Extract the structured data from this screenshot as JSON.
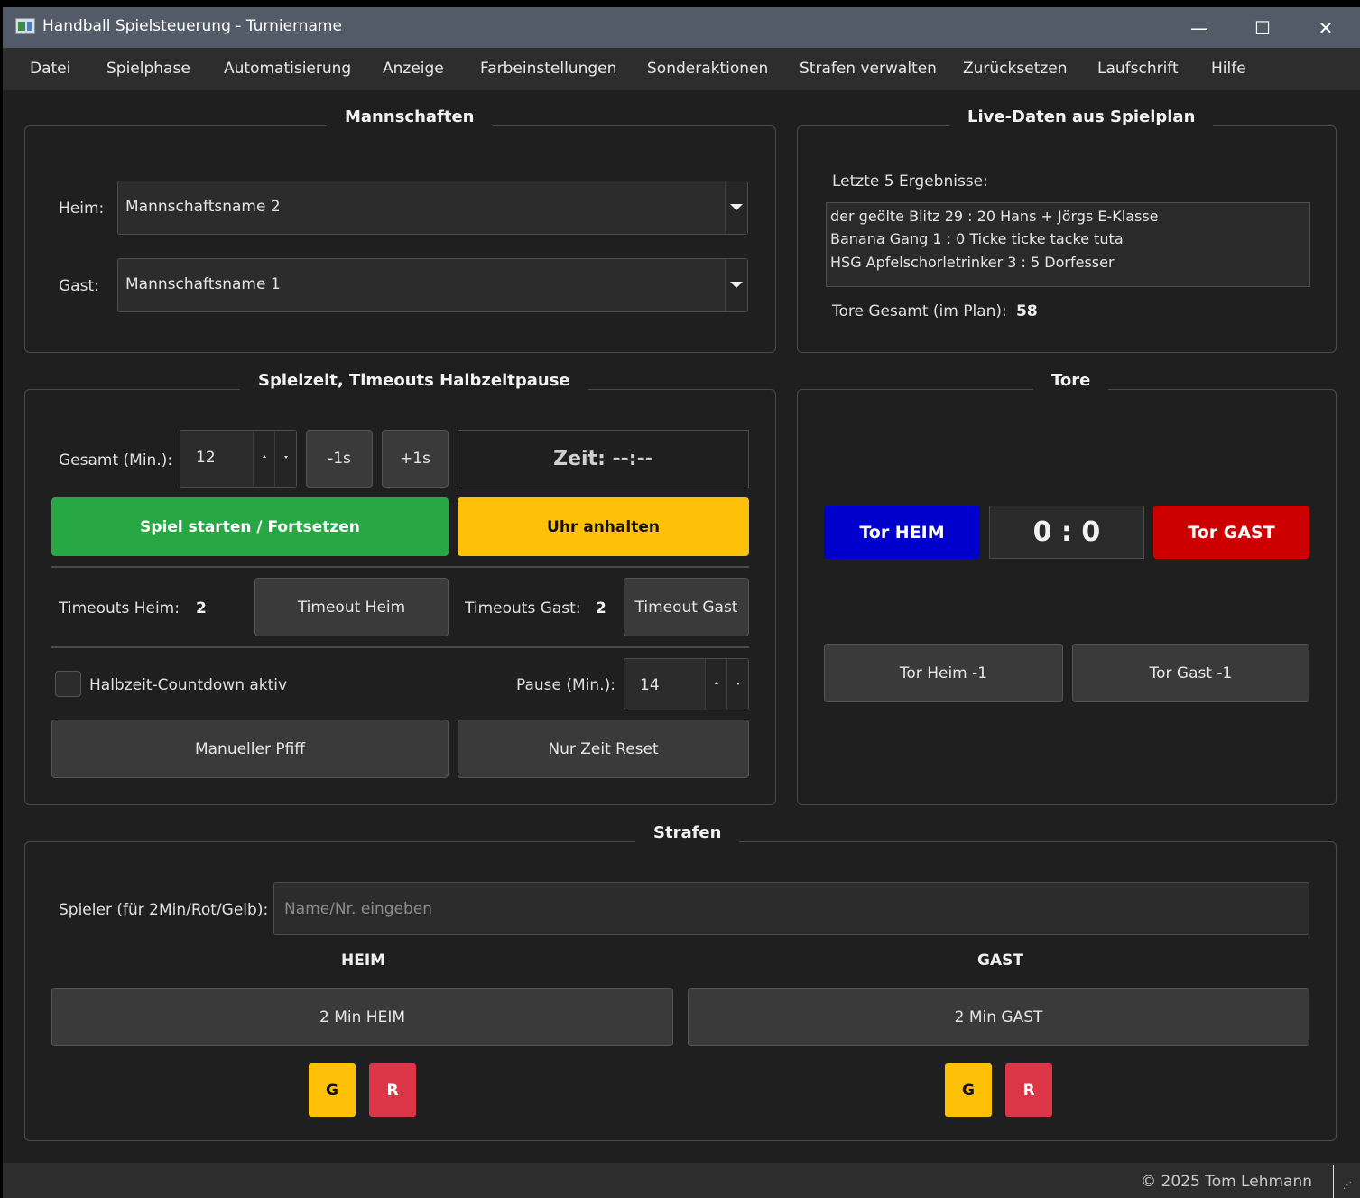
{
  "window": {
    "title": "Handball Spielsteuerung - Turniername",
    "minimize": "—",
    "maximize": "☐",
    "close": "✕"
  },
  "menu": [
    "Datei",
    "Spielphase",
    "Automatisierung",
    "Anzeige",
    "Farbeinstellungen",
    "Sonderaktionen",
    "Strafen verwalten",
    "Zurücksetzen",
    "Laufschrift",
    "Hilfe"
  ],
  "teams": {
    "title": "Mannschaften",
    "heim_label": "Heim:",
    "heim_value": "Mannschaftsname 2",
    "gast_label": "Gast:",
    "gast_value": "Mannschaftsname 1"
  },
  "live": {
    "title": "Live-Daten aus Spielplan",
    "last_results_label": "Letzte 5 Ergebnisse:",
    "results": [
      "der geölte Blitz  29 : 20  Hans + Jörgs E-Klasse",
      "Banana Gang  1 : 0  Ticke ticke tacke tuta",
      "HSG Apfelschorletrinker  3 : 5  Dorfesser"
    ],
    "total_goals_label": "Tore Gesamt (im Plan):",
    "total_goals_value": "58"
  },
  "time": {
    "title": "Spielzeit, Timeouts  Halbzeitpause",
    "total_label": "Gesamt (Min.):",
    "total_value": "12",
    "minus_btn": "-1s",
    "plus_btn": "+1s",
    "zeit_display": "Zeit: --:--",
    "start_btn": "Spiel starten / Fortsetzen",
    "stop_btn": "Uhr anhalten",
    "timeouts_heim_label": "Timeouts Heim:",
    "timeouts_heim_value": "2",
    "timeout_heim_btn": "Timeout Heim",
    "timeouts_gast_label": "Timeouts Gast:",
    "timeouts_gast_value": "2",
    "timeout_gast_btn": "Timeout Gast",
    "halftime_checkbox_label": "Halbzeit-Countdown aktiv",
    "halftime_checked": false,
    "pause_label": "Pause (Min.):",
    "pause_value": "14",
    "whistle_btn": "Manueller Pfiff",
    "reset_btn": "Nur Zeit Reset"
  },
  "goals": {
    "title": "Tore",
    "tor_heim_btn": "Tor HEIM",
    "score": "0 : 0",
    "tor_gast_btn": "Tor GAST",
    "heim_minus_btn": "Tor Heim -1",
    "gast_minus_btn": "Tor Gast -1"
  },
  "penalties": {
    "title": "Strafen",
    "player_label": "Spieler (für 2Min/Rot/Gelb):",
    "player_placeholder": "Name/Nr. eingeben",
    "heim_header": "HEIM",
    "gast_header": "GAST",
    "heim_2min_btn": "2 Min HEIM",
    "gast_2min_btn": "2 Min GAST",
    "yellow": "G",
    "red": "R"
  },
  "footer": {
    "copyright": "© 2025 Tom Lehmann"
  },
  "colors": {
    "green": "#27a844",
    "yellow": "#ffc107",
    "blue": "#0000cc",
    "red_goal": "#cc0000",
    "red_card": "#dc3545"
  }
}
